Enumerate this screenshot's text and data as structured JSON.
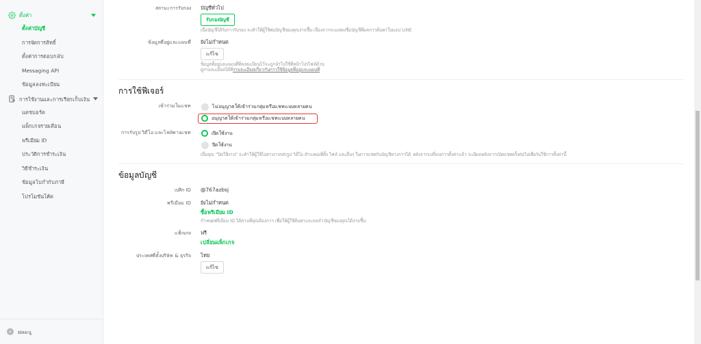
{
  "sidebar": {
    "groups": [
      {
        "label": "ตั้งค่า",
        "expanded": true,
        "selected": true,
        "items": [
          {
            "label": "ตั้งค่าบัญชี",
            "selected": true
          },
          {
            "label": "การจัดการสิทธิ์",
            "selected": false
          },
          {
            "label": "ตั้งค่าการตอบกลับ",
            "selected": false
          },
          {
            "label": "Messaging API",
            "selected": false
          },
          {
            "label": "ข้อมูลลงทะเบียน",
            "selected": false
          }
        ]
      },
      {
        "label": "การใช้งานและการเรียกเก็บเงิน",
        "expanded": true,
        "selected": false,
        "items": [
          {
            "label": "แดชบอร์ด",
            "selected": false
          },
          {
            "label": "แพ็กเกจรายเดือน",
            "selected": false
          },
          {
            "label": "พรีเมียม ID",
            "selected": false
          },
          {
            "label": "ประวัติการชำระเงิน",
            "selected": false
          },
          {
            "label": "วิธีชำระเงิน",
            "selected": false
          },
          {
            "label": "ข้อมูลใบกำกับภาษี",
            "selected": false
          },
          {
            "label": "โปรโมชันโค้ด",
            "selected": false
          }
        ]
      }
    ],
    "collapse": "ย่อเมนู"
  },
  "sections": [
    {
      "rows": [
        {
          "label": "สถานะการรับรอง",
          "value": "บัญชีทั่วไป",
          "button": {
            "label": "รับรองบัญชี",
            "primary": true
          },
          "help": "เมื่อบัญชีได้รับการรับรอง จะทำให้ผู้ใช้พบบัญชีของคุณง่ายขึ้น เนื่องจากจะแสดงชื่อบัญชีที่ผลการค้นหาในแอป LINE"
        },
        {
          "label": "ข้อมูลที่อยู่และแผนที่",
          "value": "ยังไม่กำหนด",
          "button": {
            "label": "แก้ไข",
            "primary": false
          },
          "help": "ข้อมูลที่อยู่และแผนที่ที่ลงทะเบียนไว้จะถูกนำไปใช้ที่หน้าโปรไฟล์ด้วย",
          "help_2": "ดูรายละเอียดได้ที่",
          "help_link": "รายละเอียดเกี่ยวกับการใช้ข้อมูลที่อยู่และแผนที่"
        }
      ]
    },
    {
      "title": "การใช้ฟีเจอร์",
      "rows": [
        {
          "label": "เข้าร่วมในแชท",
          "options": [
            {
              "label": "ไม่อนุญาตให้เข้าร่วมกลุ่มหรือแชทแบบหลายคน",
              "selected": false,
              "highlighted": false
            },
            {
              "label": "อนุญาตให้เข้าร่วมกลุ่มหรือแชทแบบหลายคน",
              "selected": true,
              "highlighted": true
            }
          ]
        },
        {
          "label": "การรับรูป วิดีโอ และไฟล์ทางแชท",
          "options": [
            {
              "label": "เปิดใช้งาน",
              "selected": true,
              "highlighted": false
            },
            {
              "label": "ปิดใช้งาน",
              "selected": false,
              "highlighted": false
            }
          ],
          "help": "เมื่อคุณ \"ปิดใช้งาน\" จะทำให้ผู้ใช้ไม่สามารถส่งรูป วิดีโอ ตำแหน่งที่ตั้ง ไฟล์ และอื่นๆ ในการแชทกับบัญชีทางการได้ หลังจากเปลี่ยนการตั้งค่าแล้ว จะมีผลหลังจากเปิดแชทครั้งต่อไปเพื่อรับใช้การตั้งค่านี้"
        }
      ]
    },
    {
      "title": "ข้อมูลบัญชี",
      "rows": [
        {
          "label": "เบสิก ID",
          "value": "@767azbsj"
        },
        {
          "label": "พรีเมียม ID",
          "value": "ยังไม่กำหนด",
          "link": "ซื้อพรีเมียม ID",
          "help": "กำหนดพรีเมียม ID ได้ตามที่คุณต้องการ เพื่อให้ผู้ใช้ค้นหาและจดจำบัญชีของคุณได้ง่ายขึ้น"
        },
        {
          "label": "แพ็กเกจ",
          "value": "ฟรี",
          "link": "เปลี่ยนแพ็กเกจ"
        },
        {
          "label": "ประเทศที่ตั้งบริษัท & ธุรกิจ",
          "value": "ไทย",
          "button": {
            "label": "แก้ไข",
            "primary": false
          }
        }
      ]
    }
  ]
}
